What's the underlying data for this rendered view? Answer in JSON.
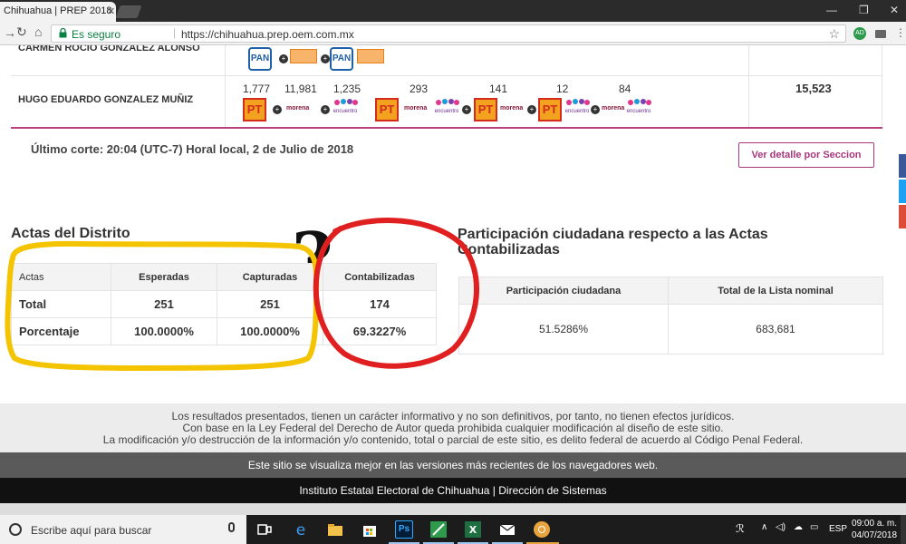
{
  "browser": {
    "tab_title": "Chihuahua | PREP 2018",
    "tab_close": "✕",
    "secure_label": "Es seguro",
    "url": "https://chihuahua.prep.oem.com.mx",
    "profile_initials": "AD"
  },
  "results": {
    "rows": [
      {
        "candidate": "CARMEN ROCIO GONZALEZ ALONSO"
      },
      {
        "candidate": "HUGO EDUARDO GONZALEZ MUÑIZ",
        "votes": [
          "1,777",
          "11,981",
          "1,235",
          "293",
          "141",
          "12",
          "84"
        ],
        "total": "15,523"
      }
    ],
    "party_labels": {
      "pan": "PAN",
      "pt": "PT",
      "morena": "morena",
      "encuentro": "encuentro"
    }
  },
  "ultimo_corte": "Último corte: 20:04 (UTC-7) Horal local, 2 de Julio de 2018",
  "ver_detalle": "Ver detalle por Seccion",
  "annotation_question": "?",
  "actas": {
    "heading": "Actas del Distrito",
    "headers": [
      "Actas",
      "Esperadas",
      "Capturadas",
      "Contabilizadas"
    ],
    "rows": [
      [
        "Total",
        "251",
        "251",
        "174"
      ],
      [
        "Porcentaje",
        "100.0000%",
        "100.0000%",
        "69.3227%"
      ]
    ]
  },
  "participacion": {
    "heading": "Participación ciudadana respecto a las Actas Contabilizadas",
    "headers": [
      "Participación ciudadana",
      "Total de la Lista nominal"
    ],
    "values": [
      "51.5286%",
      "683,681"
    ]
  },
  "footer": {
    "disclaimer": [
      "Los resultados presentados, tienen un carácter informativo y no son definitivos, por tanto, no tienen efectos jurídicos.",
      "Con base en la Ley Federal del Derecho de Autor queda prohibida cualquier modificación al diseño de este sitio.",
      "La modificación y/o destrucción de la información y/o contenido, total o parcial de este sitio, es delito federal de acuerdo al Código Penal Federal."
    ],
    "browser_note": "Este sitio se visualiza mejor en las versiones más recientes de los navegadores web.",
    "institute": "Instituto Estatal Electoral de Chihuahua | Dirección de Sistemas"
  },
  "taskbar": {
    "search_placeholder": "Escribe aquí para buscar",
    "language": "ESP",
    "time": "09:00 a. m.",
    "date": "04/07/2018"
  },
  "colors": {
    "accent": "#b7417f",
    "annotation_yellow": "#f5c400",
    "annotation_red": "#e02020"
  }
}
